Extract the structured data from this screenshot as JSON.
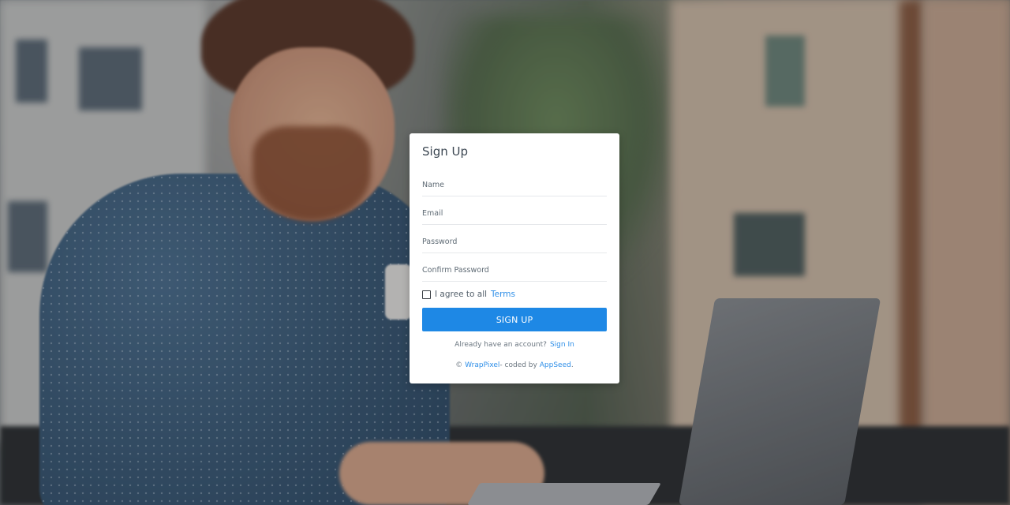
{
  "signup": {
    "title": "Sign Up",
    "fields": {
      "name_placeholder": "Name",
      "email_placeholder": "Email",
      "password_placeholder": "Password",
      "confirm_password_placeholder": "Confirm Password"
    },
    "terms": {
      "prefix": "I agree to all",
      "link_label": "Terms",
      "checked": false
    },
    "submit_label": "SIGN UP",
    "signin": {
      "prompt": "Already have an account?",
      "link_label": "Sign In"
    },
    "footer": {
      "copyright": "©",
      "brand_link": "WrapPixel",
      "middle": "- coded by",
      "author_link": "AppSeed",
      "end": "."
    }
  },
  "colors": {
    "accent": "#1e88e5",
    "link": "#2f8fe8",
    "card_background": "#ffffff"
  },
  "background": {
    "icon": "photo-person-laptop"
  }
}
